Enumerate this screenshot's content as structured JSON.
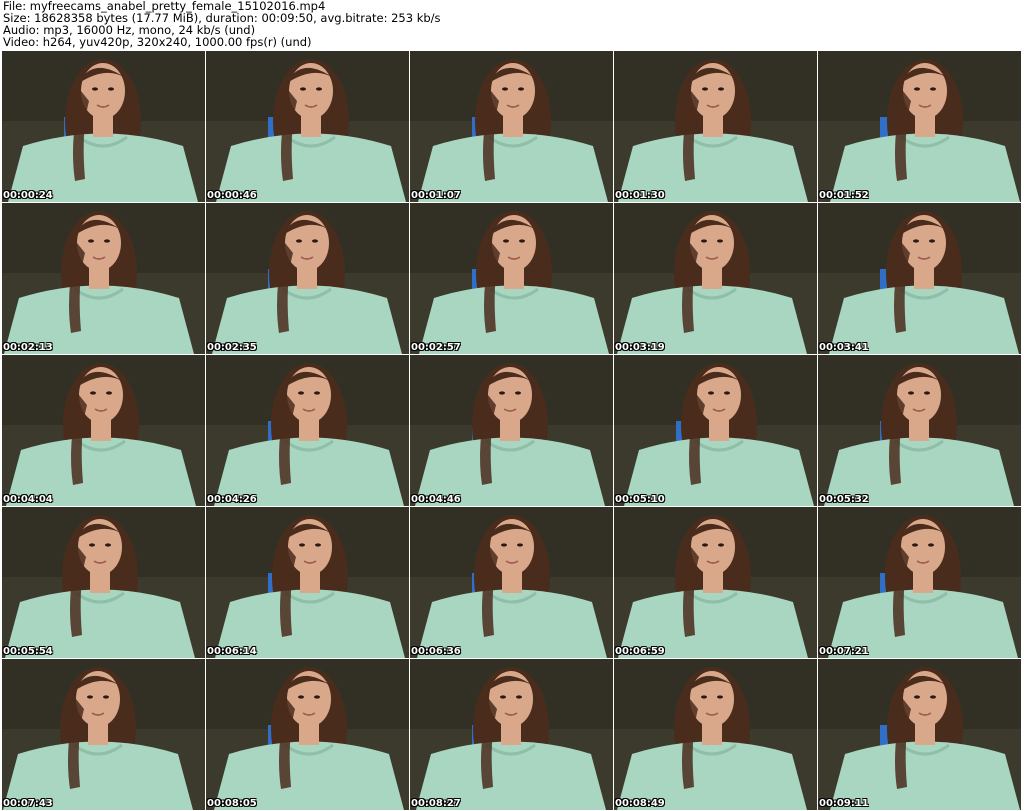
{
  "header": {
    "file_line": "File: myfreecams_anabel_pretty_female_15102016.mp4",
    "size_line": "Size: 18628358 bytes (17.77 MiB), duration: 00:09:50, avg.bitrate: 253 kb/s",
    "audio_line": "Audio: mp3, 16000 Hz, mono, 24 kb/s (und)",
    "video_line": "Video: h264, yuv420p, 320x240, 1000.00 fps(r) (und)"
  },
  "frames": [
    {
      "time": "00:00:24"
    },
    {
      "time": "00:00:46"
    },
    {
      "time": "00:01:07"
    },
    {
      "time": "00:01:30"
    },
    {
      "time": "00:01:52"
    },
    {
      "time": "00:02:13"
    },
    {
      "time": "00:02:35"
    },
    {
      "time": "00:02:57"
    },
    {
      "time": "00:03:19"
    },
    {
      "time": "00:03:41"
    },
    {
      "time": "00:04:04"
    },
    {
      "time": "00:04:26"
    },
    {
      "time": "00:04:46"
    },
    {
      "time": "00:05:10"
    },
    {
      "time": "00:05:32"
    },
    {
      "time": "00:05:54"
    },
    {
      "time": "00:06:14"
    },
    {
      "time": "00:06:36"
    },
    {
      "time": "00:06:59"
    },
    {
      "time": "00:07:21"
    },
    {
      "time": "00:07:43"
    },
    {
      "time": "00:08:05"
    },
    {
      "time": "00:08:27"
    },
    {
      "time": "00:08:49"
    },
    {
      "time": "00:09:11"
    }
  ],
  "colors": {
    "background": "#3c3a2c",
    "wall": "#2e2c22",
    "window": "#2f6fc8",
    "sweater": "#a8d6c0",
    "skin": "#d9a88a",
    "hair": "#4a2c1c",
    "timestamp_text": "#ffffff"
  }
}
